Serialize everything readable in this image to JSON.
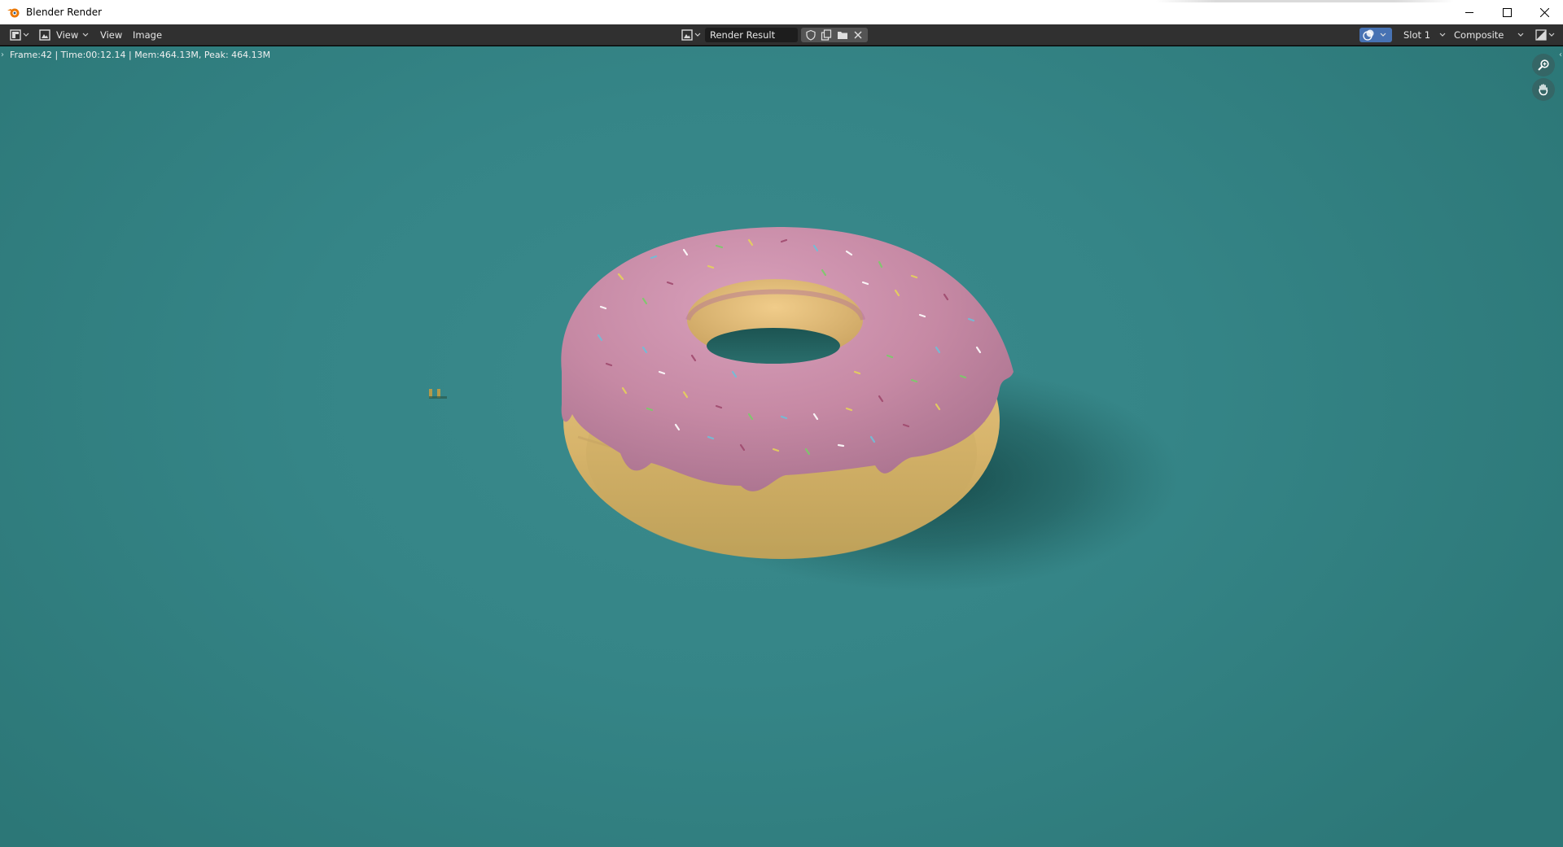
{
  "window": {
    "title": "Blender Render"
  },
  "header": {
    "view_menu_1": "View",
    "view_menu_2": "View",
    "image_menu": "Image",
    "image_name": "Render Result",
    "slot": "Slot 1",
    "pass": "Composite"
  },
  "viewport": {
    "stats": "Frame:42 | Time:00:12.14 | Mem:464.13M, Peak: 464.13M"
  },
  "colors": {
    "background": "#358587",
    "icing": "#c98aa6",
    "dough": "#e3c27a",
    "header": "#303030"
  },
  "icons": [
    "blender-logo",
    "editor-type-icon",
    "image-mode-icon",
    "browse-image-icon",
    "fake-user-icon",
    "new-image-icon",
    "open-image-icon",
    "close-icon",
    "overlay-icon",
    "display-channels-icon",
    "zoom-icon",
    "pan-icon",
    "minimize-icon",
    "maximize-icon",
    "window-close-icon"
  ]
}
